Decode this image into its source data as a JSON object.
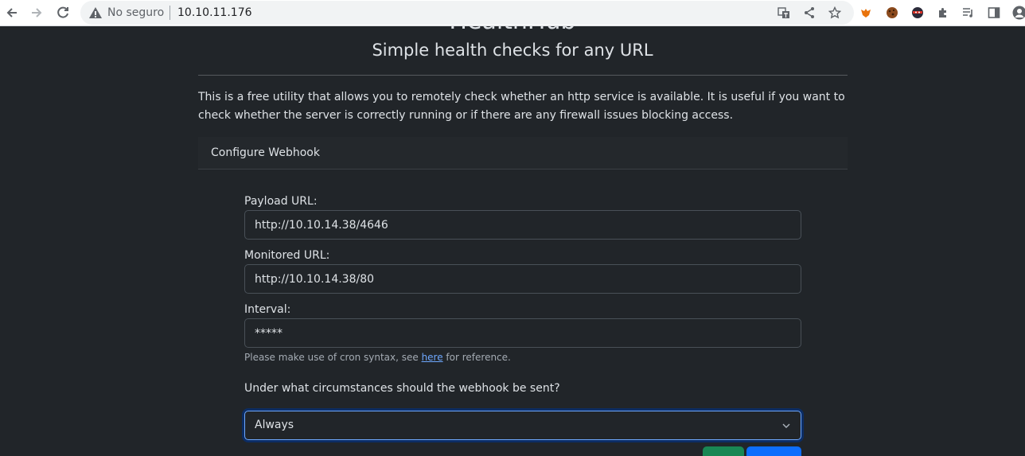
{
  "browser": {
    "security_label": "No seguro",
    "url": "10.10.11.176"
  },
  "page": {
    "title": "HealthHub",
    "subtitle": "Simple health checks for any URL",
    "description": "This is a free utility that allows you to remotely check whether an http service is available. It is useful if you want to check whether the server is correctly running or if there are any firewall issues blocking access.",
    "card_header": "Configure Webhook"
  },
  "form": {
    "payload_label": "Payload URL:",
    "payload_value": "http://10.10.14.38/4646",
    "monitored_label": "Monitored URL:",
    "monitored_value": "http://10.10.14.38/80",
    "interval_label": "Interval:",
    "interval_value": "*****",
    "help_prefix": "Please make use of cron syntax, see ",
    "help_link": "here",
    "help_suffix": " for reference.",
    "question": "Under what circumstances should the webhook be sent?",
    "select_value": "Always"
  },
  "colors": {
    "background": "#212529",
    "link": "#6ea8fe",
    "green_button": "#198754",
    "blue_button": "#0d6efd"
  }
}
